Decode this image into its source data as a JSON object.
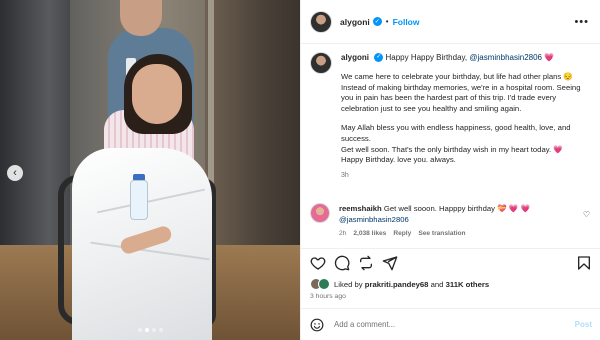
{
  "post": {
    "username": "alygoni",
    "follow_label": "Follow",
    "separator": "•",
    "more_glyph": "•••",
    "carousel": {
      "total_images": 4,
      "current_index": 1,
      "prev_glyph": "‹"
    }
  },
  "caption": {
    "username": "alygoni",
    "opening": "Happy Happy Birthday,",
    "mention": "@jasminbhasin2806",
    "heart": "💗",
    "paragraphs": [
      "We came here to celebrate your birthday, but life had other plans 😔 Instead of making birthday memories, we're in a hospital room. Seeing you in pain has been the hardest part of this trip. I'd trade every celebration just to see you healthy and smiling again.",
      "May Allah bless you with endless happiness, good health, love, and success.\nGet well soon. That's the only birthday wish in my heart today. 💗\nHappy Birthday. love you. always."
    ],
    "time": "3h"
  },
  "comment": {
    "username": "reemshaikh",
    "text": "Get well sooon. Happpy birthday 💝 💗 💗",
    "mention": "@jasminbhasin2806",
    "time": "2h",
    "likes": "2,038 likes",
    "reply_label": "Reply",
    "translate_label": "See translation",
    "like_glyph": "♡"
  },
  "engagement": {
    "liked_by_prefix": "Liked by",
    "liked_by_user": "prakriti.pandey68",
    "and_text": "and",
    "others_count": "311K others",
    "posted_ago": "3 hours ago"
  },
  "add_comment": {
    "placeholder": "Add a comment...",
    "post_label": "Post"
  },
  "icons": [
    "verified-badge-icon",
    "more-options-icon",
    "heart-icon",
    "comment-icon",
    "share-icon",
    "save-icon",
    "emoji-icon",
    "carousel-prev-icon"
  ],
  "colors": {
    "accent": "#0095f6",
    "mention": "#00376b",
    "muted": "#737373",
    "heart": "#ed2553",
    "post_disabled": "#b2dffc"
  }
}
